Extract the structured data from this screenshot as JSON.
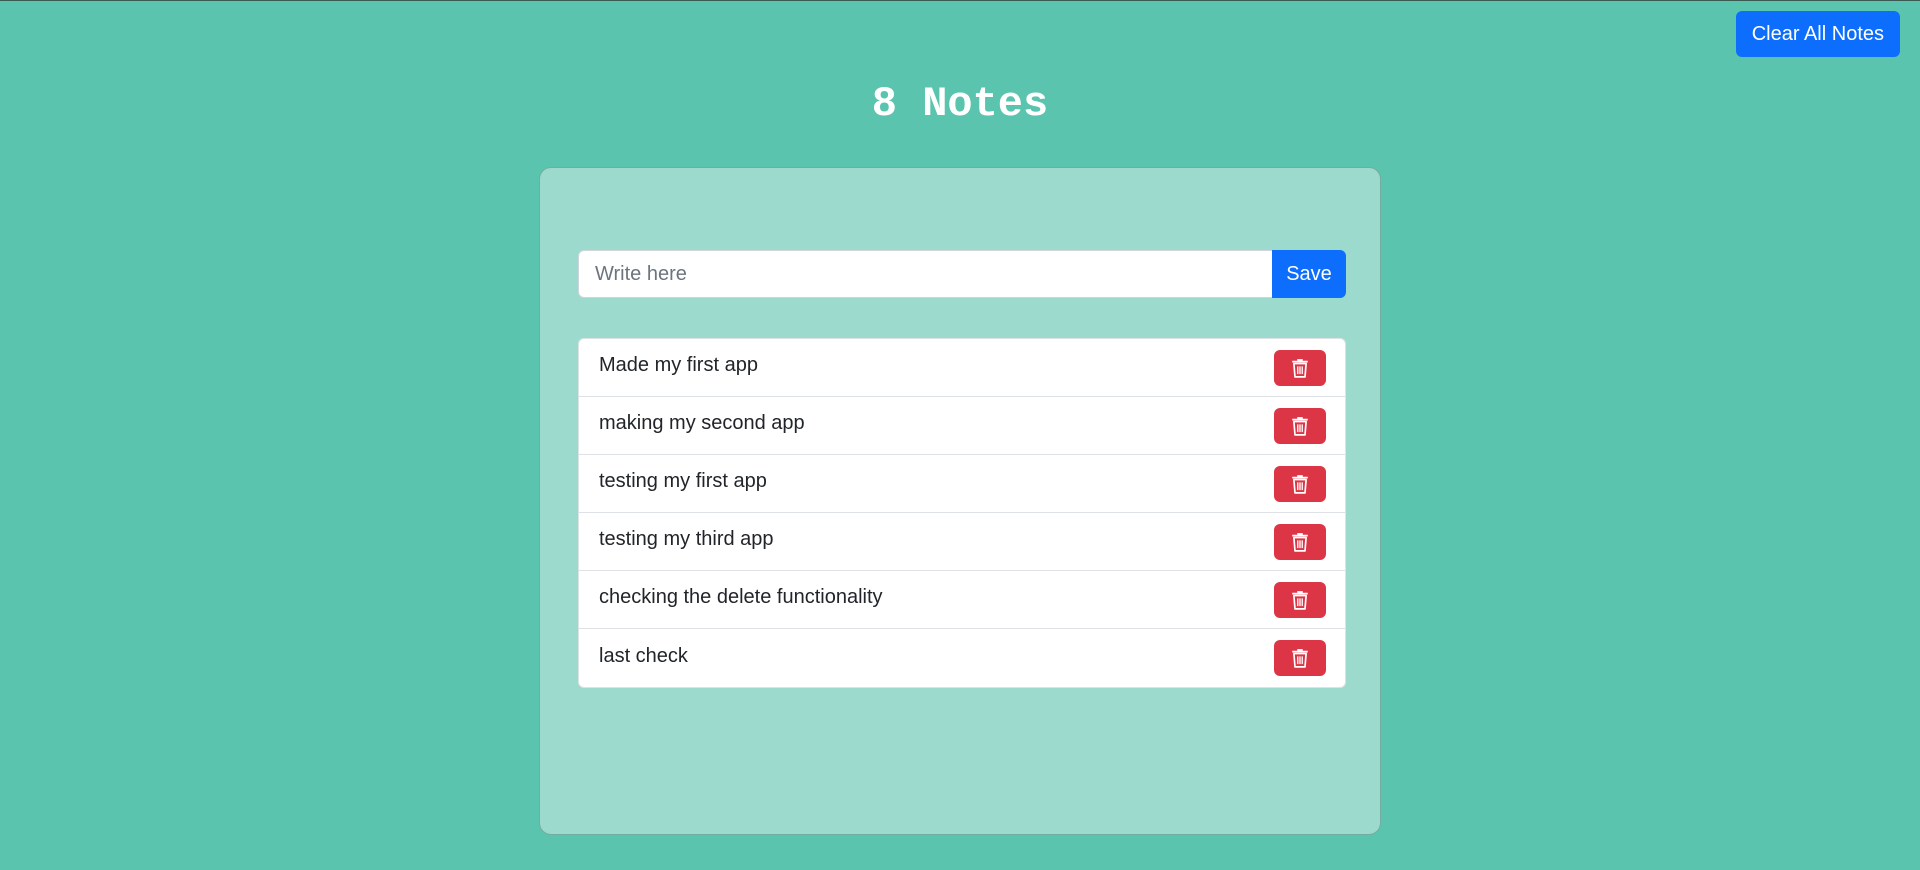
{
  "header": {
    "clear_all_label": "Clear All Notes",
    "title": "8 Notes"
  },
  "form": {
    "input_value": "",
    "input_placeholder": "Write here",
    "save_label": "Save"
  },
  "notes": [
    {
      "text": "Made my first app",
      "action_icon": "trash-icon"
    },
    {
      "text": "making my second app",
      "action_icon": "trash-icon"
    },
    {
      "text": "testing my first app",
      "action_icon": "trash-icon"
    },
    {
      "text": "testing my third app",
      "action_icon": "trash-icon"
    },
    {
      "text": "checking the delete functionality",
      "action_icon": "trash-icon"
    },
    {
      "text": "last check",
      "action_icon": "trash-icon"
    }
  ],
  "colors": {
    "background": "#5bc4ae",
    "card": "#9cdacd",
    "primary": "#0d6efd",
    "danger": "#dc3545"
  }
}
